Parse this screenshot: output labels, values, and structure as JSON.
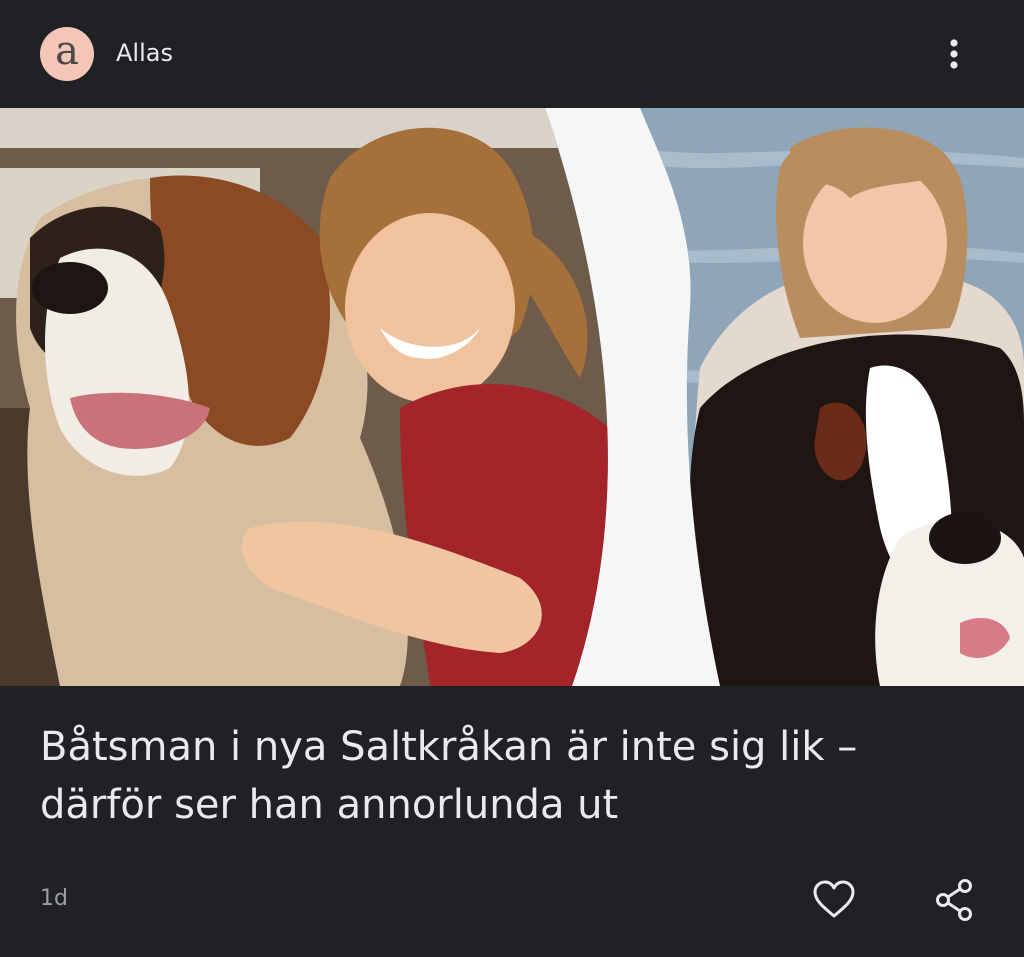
{
  "header": {
    "avatar_letter": "a",
    "source_name": "Allas",
    "more_icon": "more-vert-icon"
  },
  "article": {
    "headline": "Båtsman i nya Saltkråkan är inte sig lik – därför ser han annorlunda ut",
    "timestamp": "1d",
    "image": "photo-collage-girl-with-st-bernard-dog"
  },
  "actions": {
    "like_icon": "heart-icon",
    "share_icon": "share-icon"
  },
  "colors": {
    "background": "#202124",
    "text": "#e8eaed",
    "muted": "#9aa0a6",
    "avatar_bg": "#f4c6b6"
  }
}
